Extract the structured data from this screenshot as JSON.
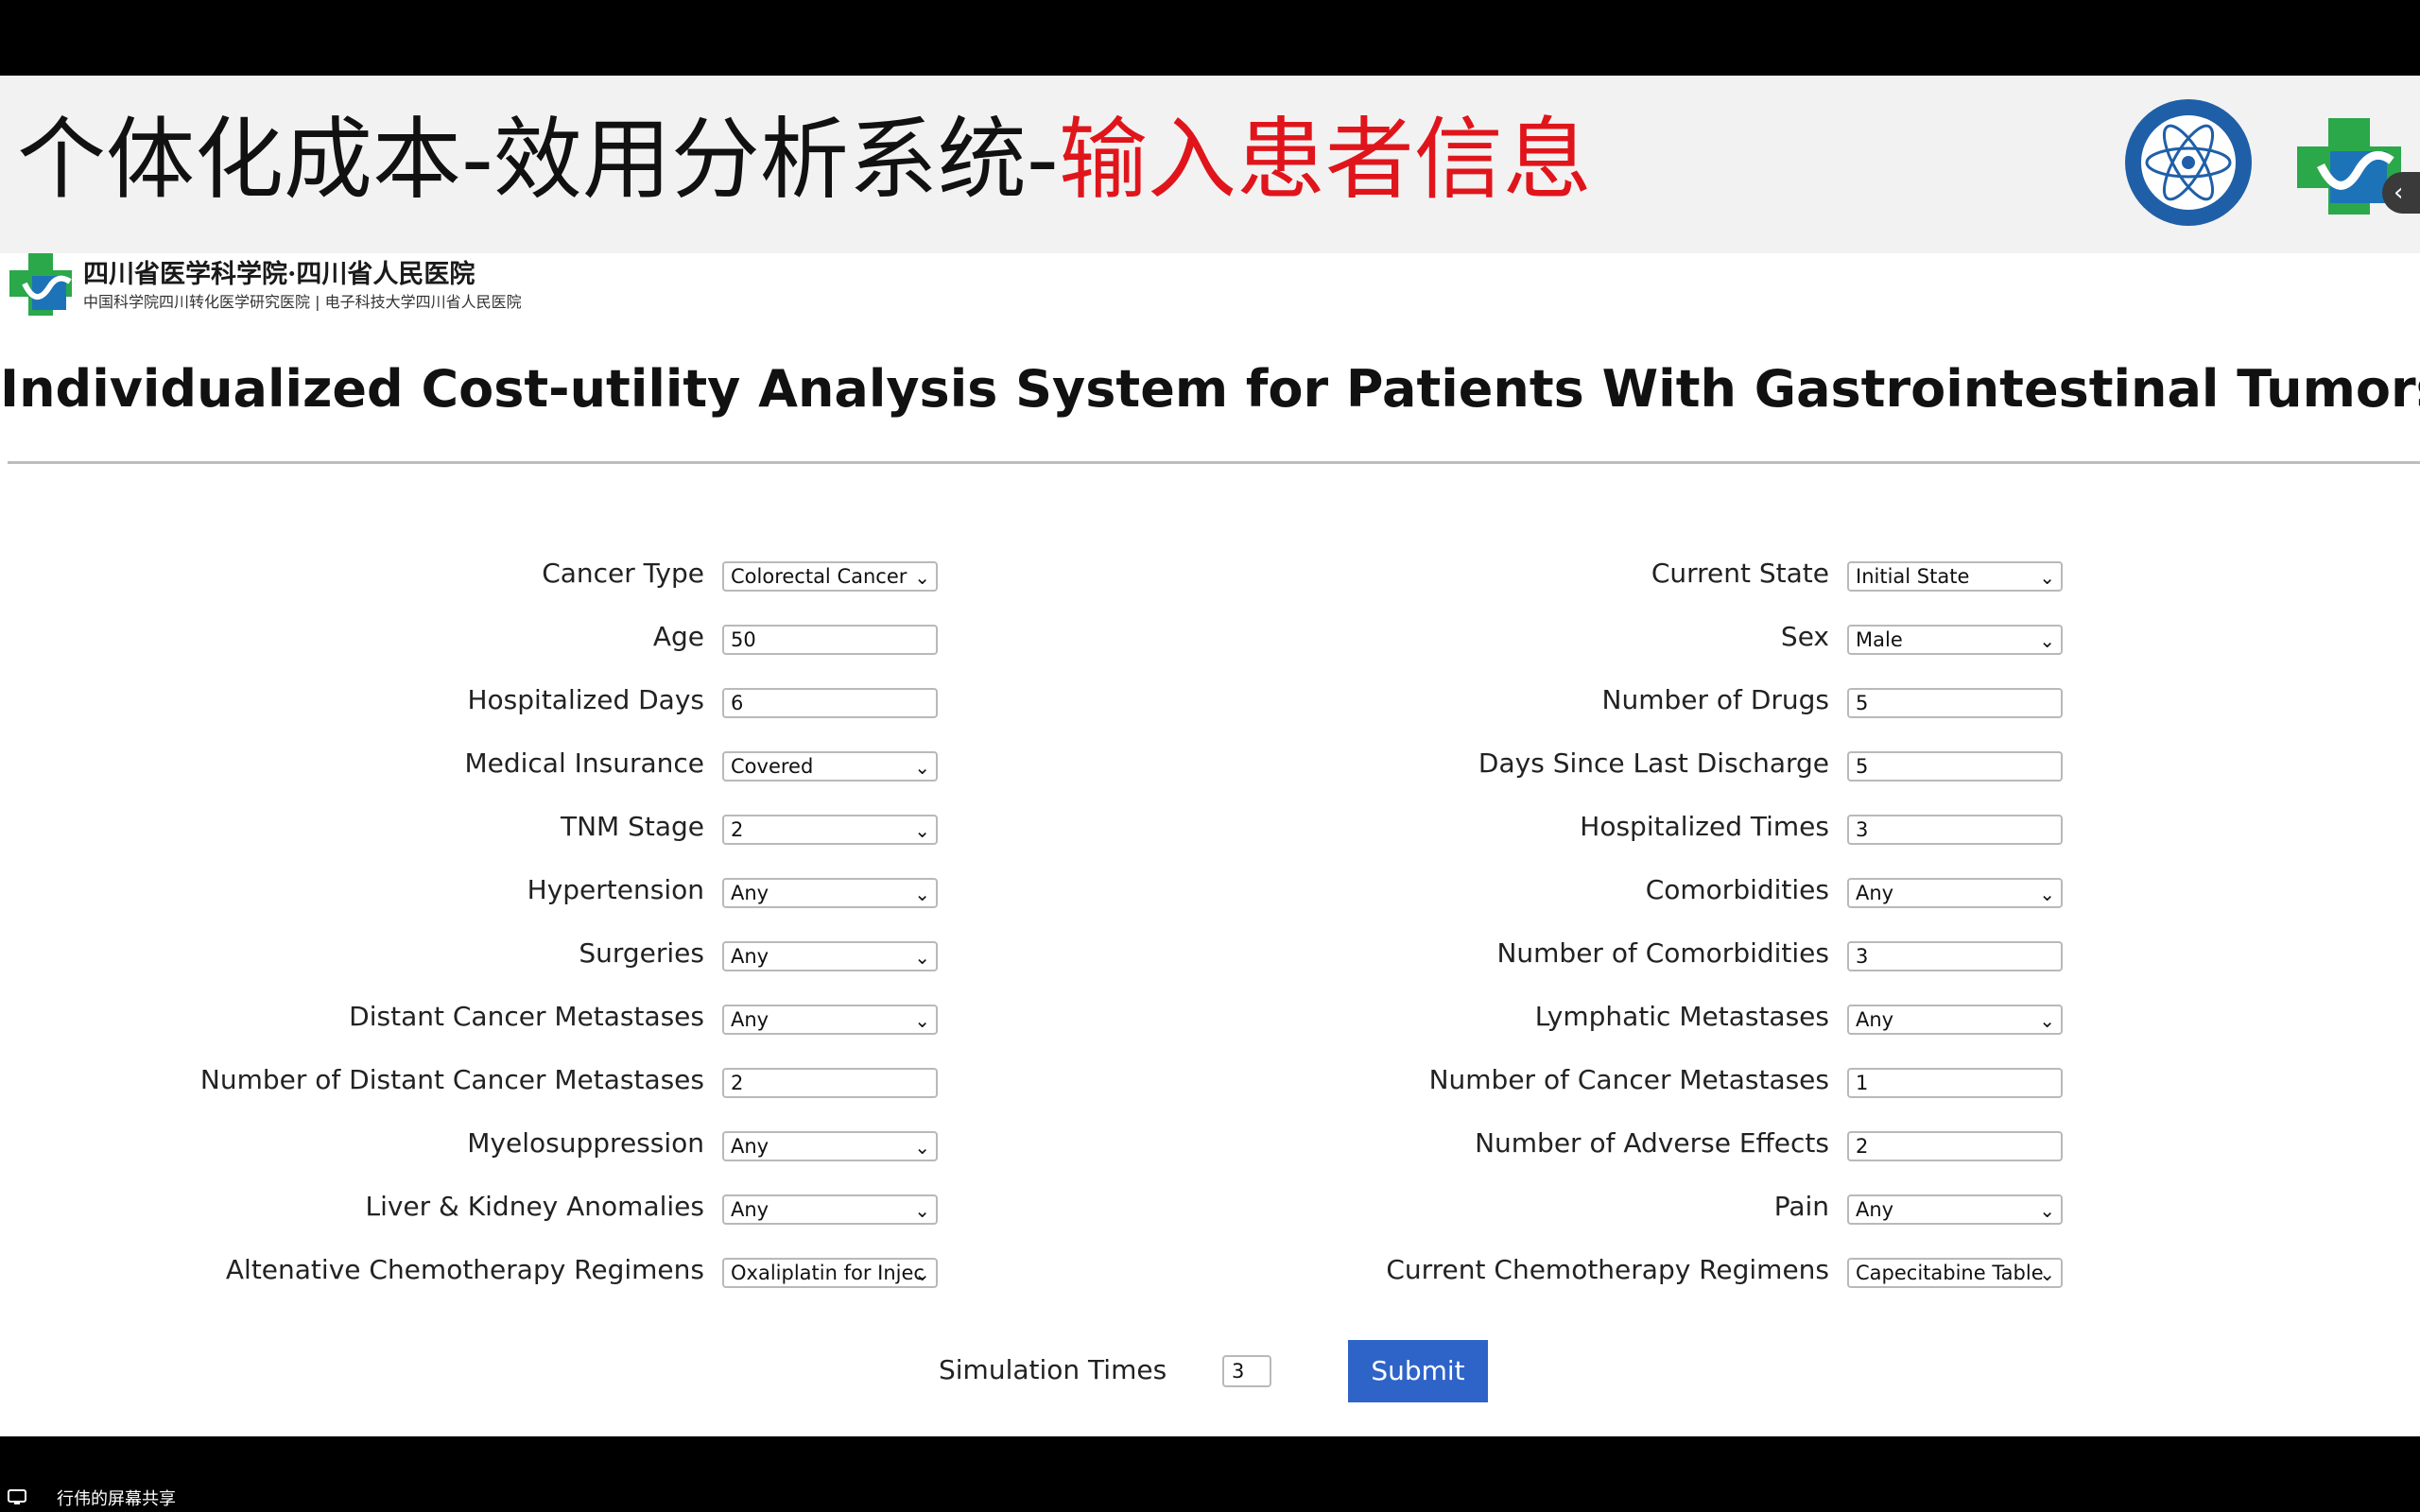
{
  "slide": {
    "title_main": "个体化成本-效用分析系统-",
    "title_highlight": "输入患者信息",
    "accent_color": "#e0151b"
  },
  "hospital": {
    "name_cn": "四川省医学科学院·四川省人民医院",
    "sub_cn": "中国科学院四川转化医学研究医院 | 电子科技大学四川省人民医院"
  },
  "form": {
    "heading": "Individualized Cost-utility Analysis System for Patients With Gastrointestinal Tumors",
    "left": [
      {
        "label": "Cancer Type",
        "value": "Colorectal Cancer",
        "kind": "select"
      },
      {
        "label": "Age",
        "value": "50",
        "kind": "input"
      },
      {
        "label": "Hospitalized Days",
        "value": "6",
        "kind": "input"
      },
      {
        "label": "Medical Insurance",
        "value": "Covered",
        "kind": "select"
      },
      {
        "label": "TNM Stage",
        "value": "2",
        "kind": "select"
      },
      {
        "label": "Hypertension",
        "value": "Any",
        "kind": "select"
      },
      {
        "label": "Surgeries",
        "value": "Any",
        "kind": "select"
      },
      {
        "label": "Distant Cancer Metastases",
        "value": "Any",
        "kind": "select"
      },
      {
        "label": "Number of Distant Cancer Metastases",
        "value": "2",
        "kind": "input"
      },
      {
        "label": "Myelosuppression",
        "value": "Any",
        "kind": "select"
      },
      {
        "label": "Liver & Kidney Anomalies",
        "value": "Any",
        "kind": "select"
      },
      {
        "label": "Altenative Chemotherapy Regimens",
        "value": "Oxaliplatin for Injec",
        "kind": "select"
      }
    ],
    "right": [
      {
        "label": "Current State",
        "value": "Initial State",
        "kind": "select"
      },
      {
        "label": "Sex",
        "value": "Male",
        "kind": "select"
      },
      {
        "label": "Number of Drugs",
        "value": "5",
        "kind": "input"
      },
      {
        "label": "Days Since Last Discharge",
        "value": "5",
        "kind": "input"
      },
      {
        "label": "Hospitalized Times",
        "value": "3",
        "kind": "input"
      },
      {
        "label": "Comorbidities",
        "value": "Any",
        "kind": "select"
      },
      {
        "label": "Number of Comorbidities",
        "value": "3",
        "kind": "input"
      },
      {
        "label": "Lymphatic Metastases",
        "value": "Any",
        "kind": "select"
      },
      {
        "label": "Number of Cancer Metastases",
        "value": "1",
        "kind": "input"
      },
      {
        "label": "Number of Adverse Effects",
        "value": "2",
        "kind": "input"
      },
      {
        "label": "Pain",
        "value": "Any",
        "kind": "select"
      },
      {
        "label": "Current Chemotherapy Regimens",
        "value": "Capecitabine Table",
        "kind": "select"
      }
    ],
    "simulation_label": "Simulation Times",
    "simulation_value": "3",
    "submit_label": "Submit",
    "submit_color": "#2e64c8"
  },
  "taskbar": {
    "share_text": "行伟的屏幕共享"
  }
}
